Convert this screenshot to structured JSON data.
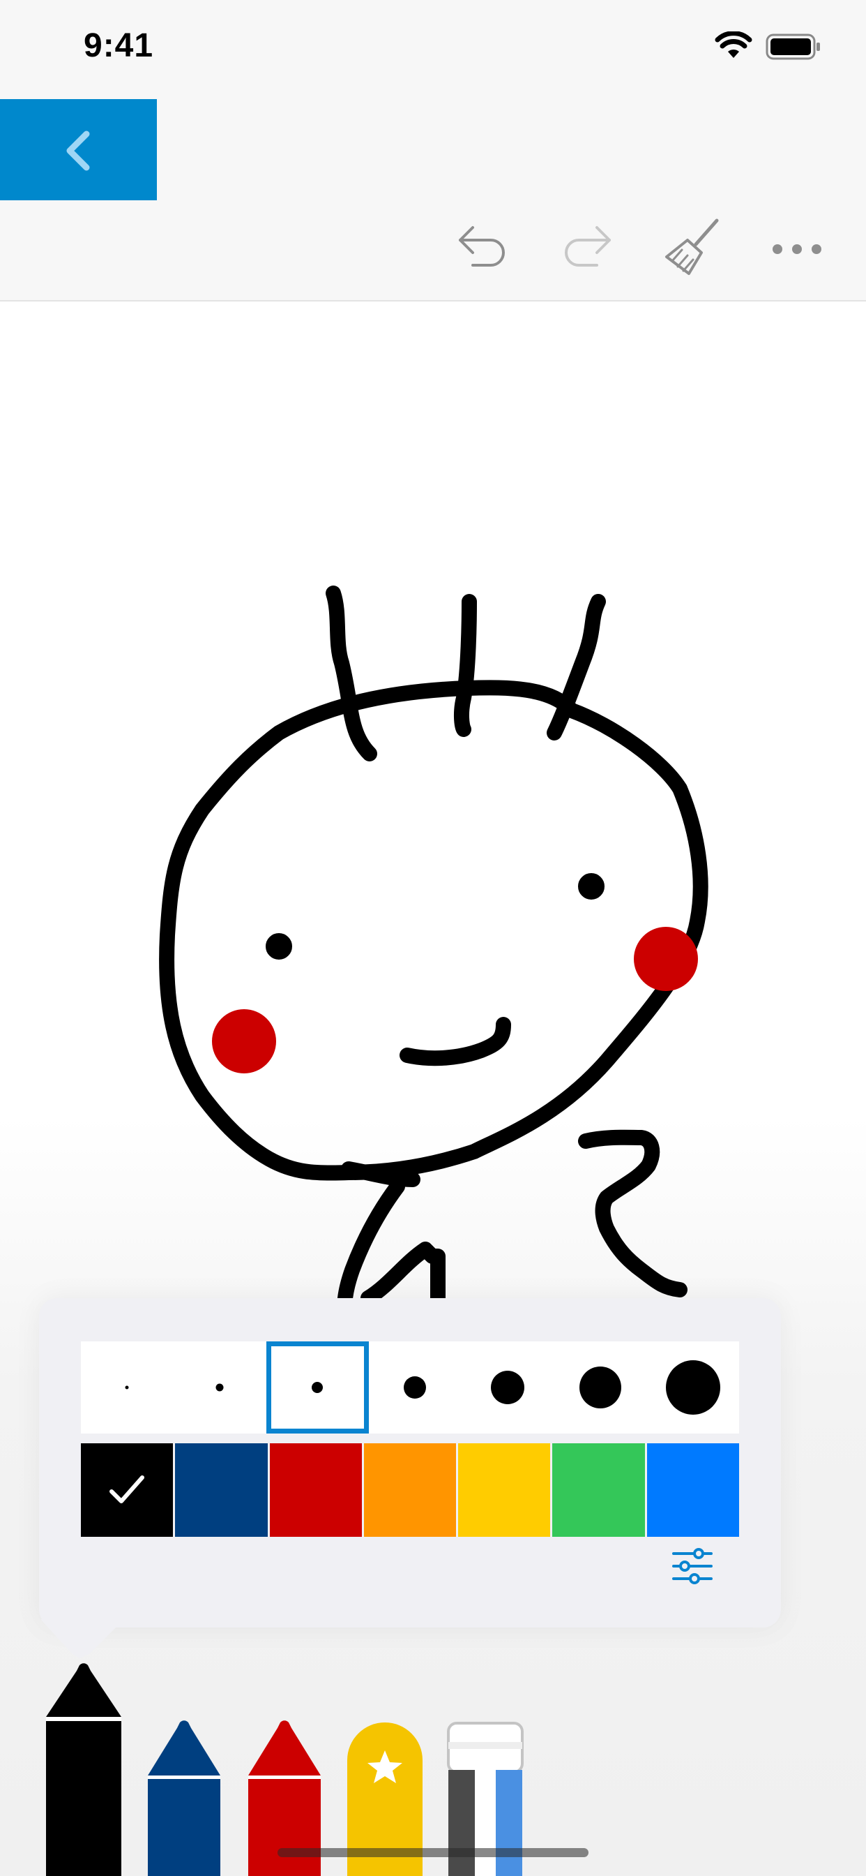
{
  "status_bar": {
    "time": "9:41",
    "wifi_icon": "wifi-icon",
    "battery_icon": "battery-icon"
  },
  "toolbar": {
    "back_icon": "chevron-left-icon",
    "undo_icon": "undo-icon",
    "redo_icon": "redo-icon",
    "clear_icon": "broom-icon",
    "more_icon": "more-dots-icon",
    "accent_color": "#0088cc"
  },
  "drawing": {
    "stroke_color": "#000000",
    "cheek_color": "#cc0000"
  },
  "brush_panel": {
    "sizes": [
      {
        "name": "size-1",
        "selected": false
      },
      {
        "name": "size-2",
        "selected": false
      },
      {
        "name": "size-3",
        "selected": true
      },
      {
        "name": "size-4",
        "selected": false
      },
      {
        "name": "size-5",
        "selected": false
      },
      {
        "name": "size-6",
        "selected": false
      },
      {
        "name": "size-7",
        "selected": false
      }
    ],
    "colors": [
      {
        "name": "black",
        "hex": "#000000",
        "selected": true
      },
      {
        "name": "dark-blue",
        "hex": "#003f80",
        "selected": false
      },
      {
        "name": "red",
        "hex": "#cc0000",
        "selected": false
      },
      {
        "name": "orange",
        "hex": "#ff9500",
        "selected": false
      },
      {
        "name": "yellow",
        "hex": "#ffcc00",
        "selected": false
      },
      {
        "name": "green",
        "hex": "#34c759",
        "selected": false
      },
      {
        "name": "blue",
        "hex": "#007aff",
        "selected": false
      }
    ],
    "adjust_icon": "sliders-icon"
  },
  "pen_tray": [
    {
      "name": "black-pen",
      "color": "#000000",
      "selected": true
    },
    {
      "name": "blue-pen",
      "color": "#003f80",
      "selected": false
    },
    {
      "name": "red-pen",
      "color": "#cc0000",
      "selected": false
    },
    {
      "name": "favorite-pen",
      "color": "#f5c400",
      "icon": "star-icon",
      "selected": false
    },
    {
      "name": "eraser",
      "color": "#4a90e2",
      "selected": false
    }
  ]
}
